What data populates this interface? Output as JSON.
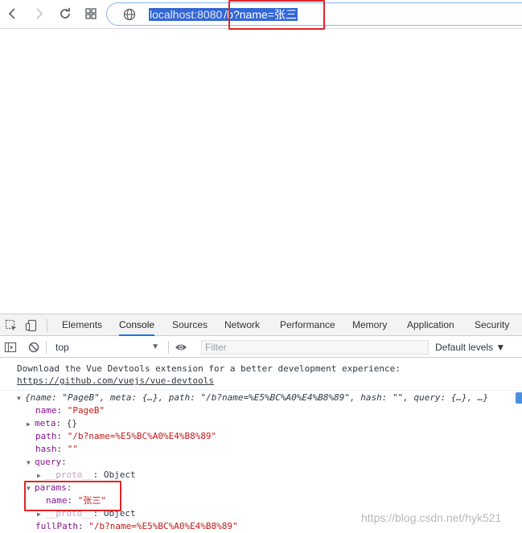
{
  "browser": {
    "url_host": "localhost:8080",
    "url_path": "/b?name=张三"
  },
  "devtools": {
    "tabs": [
      "Elements",
      "Console",
      "Sources",
      "Network",
      "Performance",
      "Memory",
      "Application",
      "Security"
    ],
    "active_tab": "Console",
    "context": "top",
    "filter_placeholder": "Filter",
    "levels": "Default levels ▼"
  },
  "console": {
    "vue_msg": "Download the Vue Devtools extension for a better development experience:",
    "vue_link": "https://github.com/vuejs/vue-devtools",
    "summary": "{name: \"PageB\", meta: {…}, path: \"/b?name=%E5%BC%A0%E4%B8%89\", hash: \"\", query: {…}, …}",
    "props": {
      "name_key": "name",
      "name_val": "\"PageB\"",
      "meta_key": "meta",
      "meta_val": "{}",
      "path_key": "path",
      "path_val": "\"/b?name=%E5%BC%A0%E4%B8%89\"",
      "hash_key": "hash",
      "hash_val": "\"\"",
      "query_key": "query",
      "proto_key": "__proto__",
      "proto_val": "Object",
      "params_key": "params",
      "params_name_key": "name",
      "params_name_val": "\"张三\"",
      "fullpath_key": "fullPath",
      "fullpath_val": "\"/b?name=%E5%BC%A0%E4%B8%89\""
    }
  },
  "watermark": "https://blog.csdn.net/hyk521",
  "colors": {
    "highlight_box": "#e02424",
    "selection": "#3367d6",
    "active_tab_underline": "#1a73e8"
  }
}
